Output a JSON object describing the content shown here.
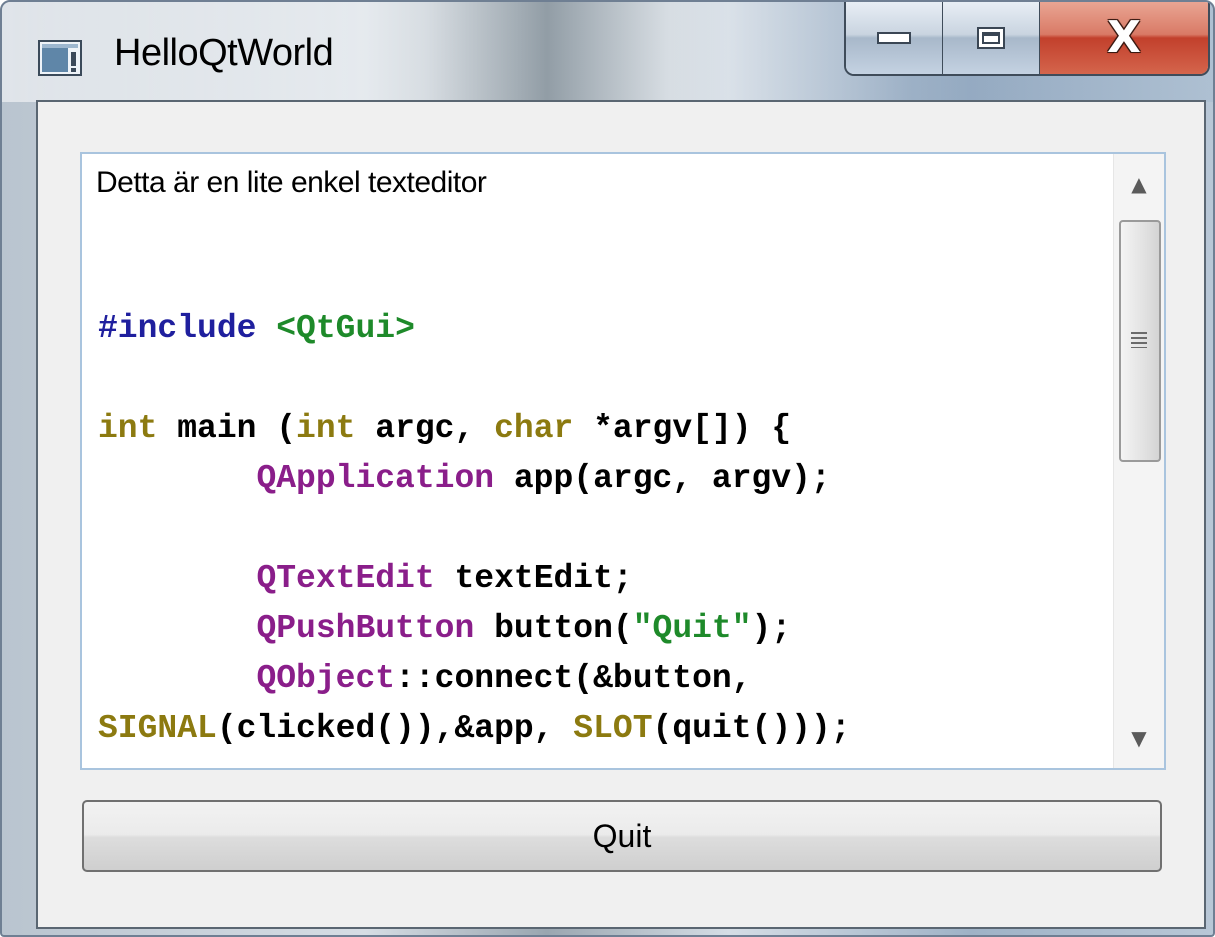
{
  "window": {
    "title": "HelloQtWorld",
    "icon": "app-icon",
    "controls": {
      "minimize_icon": "minimize-icon",
      "maximize_icon": "maximize-icon",
      "close_glyph": "X"
    }
  },
  "editor": {
    "intro_text": "Detta är en lite enkel texteditor",
    "code": {
      "line1": {
        "directive": "#include",
        "header": "<QtGui>"
      },
      "line2": {
        "kw1": "int",
        "text1": " main (",
        "kw2": "int",
        "text2": " argc, ",
        "kw3": "char",
        "text3": " *argv[]) {"
      },
      "line3": {
        "indent": "        ",
        "cls": "QApplication",
        "text": " app(argc, argv);"
      },
      "line4": {
        "indent": "        ",
        "cls": "QTextEdit",
        "text": " textEdit;"
      },
      "line5": {
        "indent": "        ",
        "cls": "QPushButton",
        "text1": " button(",
        "str": "\"Quit\"",
        "text2": ");"
      },
      "line6": {
        "indent": "        ",
        "cls": "QObject",
        "text": "::connect(&button,"
      },
      "line7": {
        "mac1": "SIGNAL",
        "text1": "(clicked()),&app, ",
        "mac2": "SLOT",
        "text2": "(quit()));"
      }
    },
    "scrollbar": {
      "up_arrow": "▲",
      "down_arrow": "▼"
    }
  },
  "buttons": {
    "quit_label": "Quit"
  },
  "colors": {
    "preprocessor": "#1f1f9e",
    "include_header": "#1e8a2a",
    "type_keyword": "#8c7a10",
    "qt_class": "#8a1e8a",
    "string": "#1e8a2a",
    "close_button": "#c2402c"
  }
}
